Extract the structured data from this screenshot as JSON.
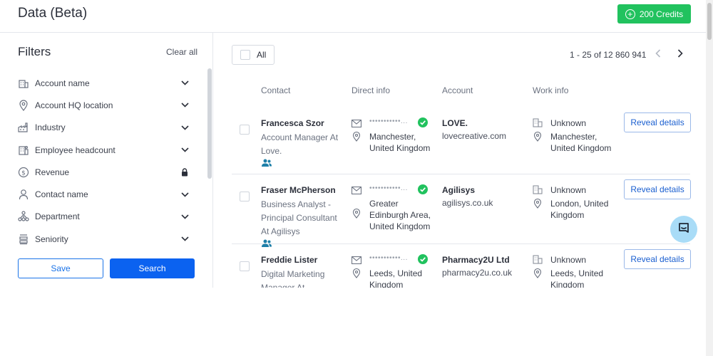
{
  "header": {
    "title": "Data (Beta)",
    "credits_label": "200 Credits"
  },
  "filters": {
    "title": "Filters",
    "clear_label": "Clear all",
    "items": [
      {
        "label": "Account name",
        "icon": "building-icon",
        "action": "chevron-down-icon"
      },
      {
        "label": "Account HQ location",
        "icon": "location-pin-icon",
        "action": "chevron-down-icon"
      },
      {
        "label": "Industry",
        "icon": "factory-icon",
        "action": "chevron-down-icon"
      },
      {
        "label": "Employee headcount",
        "icon": "headcount-icon",
        "action": "chevron-down-icon"
      },
      {
        "label": "Revenue",
        "icon": "dollar-icon",
        "action": "lock-icon"
      },
      {
        "label": "Contact name",
        "icon": "person-icon",
        "action": "chevron-down-icon"
      },
      {
        "label": "Department",
        "icon": "org-chart-icon",
        "action": "chevron-down-icon"
      },
      {
        "label": "Seniority",
        "icon": "ladder-icon",
        "action": "chevron-down-icon"
      }
    ],
    "save_label": "Save",
    "search_label": "Search"
  },
  "results": {
    "select_all_label": "All",
    "pagination": "1 - 25 of 12 860 941",
    "columns": [
      "Contact",
      "Direct info",
      "Account",
      "Work info"
    ],
    "rows": [
      {
        "name": "Francesca Szor",
        "title": "Account Manager At Love.",
        "masked_email": "•••••••••••...",
        "location": "Manchester, United Kingdom",
        "account": "LOVE.",
        "domain": "lovecreative.com",
        "work_status": "Unknown",
        "work_location": "Manchester, United Kingdom",
        "action": "Reveal details"
      },
      {
        "name": "Fraser McPherson",
        "title": "Business Analyst - Principal Consultant At Agilisys",
        "masked_email": "•••••••••••...",
        "location": "Greater Edinburgh Area, United Kingdom",
        "account": "Agilisys",
        "domain": "agilisys.co.uk",
        "work_status": "Unknown",
        "work_location": "London, United Kingdom",
        "action": "Reveal details"
      },
      {
        "name": "Freddie Lister",
        "title": "Digital Marketing Manager At",
        "masked_email": "•••••••••••...",
        "location": "Leeds, United Kingdom",
        "account": "Pharmacy2U Ltd",
        "domain": "pharmacy2u.co.uk",
        "work_status": "Unknown",
        "work_location": "Leeds, United Kingdom",
        "action": "Reveal details"
      }
    ]
  },
  "colors": {
    "accent_green": "#21c25e",
    "primary_blue": "#0b62f0",
    "verified_green": "#21c25e",
    "chat_bubble": "#a9dcf7"
  }
}
